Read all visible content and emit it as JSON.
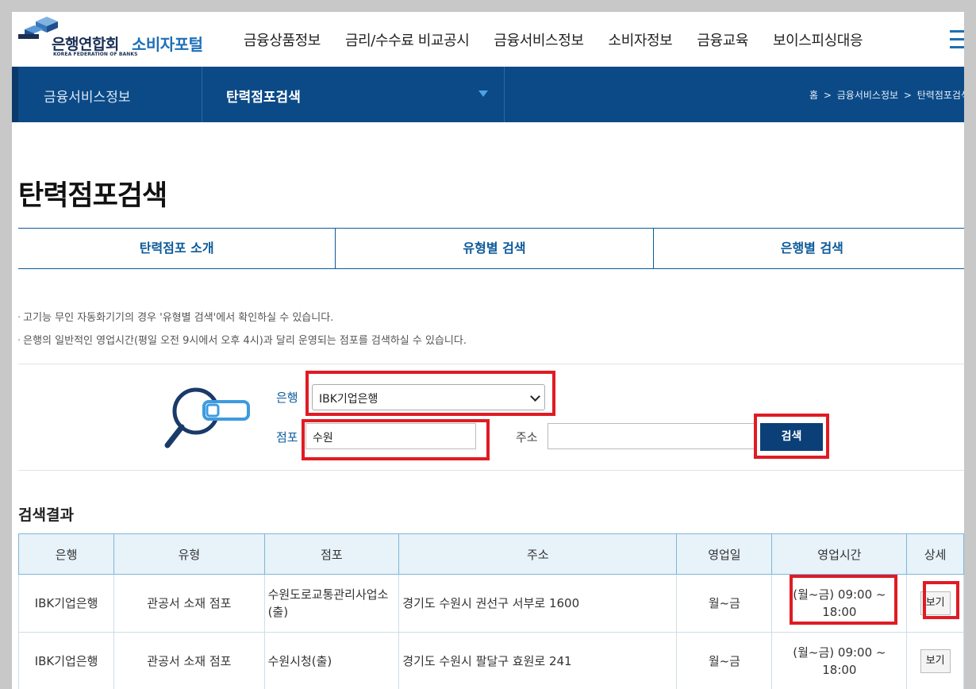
{
  "header": {
    "logo_kr": "은행연합회",
    "logo_en": "KOREA FEDERATION OF BANKS",
    "portal": "소비자포털",
    "gnb": [
      "금융상품정보",
      "금리/수수료 비교공시",
      "금융서비스정보",
      "소비자정보",
      "금융교육",
      "보이스피싱대응"
    ]
  },
  "subnav": {
    "section": "금융서비스정보",
    "current": "탄력점포검색",
    "breadcrumb": [
      "홈",
      ">",
      "금융서비스정보",
      ">",
      "탄력점포검색"
    ]
  },
  "page_title": "탄력점포검색",
  "tabs": [
    "탄력점포 소개",
    "유형별 검색",
    "은행별 검색"
  ],
  "notices": [
    "고기능 무인 자동화기기의 경우 '유형별 검색'에서 확인하실 수 있습니다.",
    "은행의 일반적인 영업시간(평일 오전 9시에서 오후 4시)과 달리 운영되는 점포를 검색하실 수 있습니다."
  ],
  "search": {
    "bank_label": "은행",
    "bank_value": "IBK기업은행",
    "branch_label": "점포",
    "branch_value": "수원",
    "address_label": "주소",
    "address_value": "",
    "button": "검색"
  },
  "results": {
    "title": "검색결과",
    "headers": [
      "은행",
      "유형",
      "점포",
      "주소",
      "영업일",
      "영업시간",
      "상세"
    ],
    "rows": [
      {
        "bank": "IBK기업은행",
        "type": "관공서 소재 점포",
        "branch": "수원도로교통관리사업소(출)",
        "address": "경기도 수원시 권선구 서부로 1600",
        "days": "월~금",
        "hours": "(월~금) 09:00 ~ 18:00",
        "detail": "보기"
      },
      {
        "bank": "IBK기업은행",
        "type": "관공서 소재 점포",
        "branch": "수원시청(출)",
        "address": "경기도 수원시 팔달구 효원로 241",
        "days": "월~금",
        "hours": "(월~금) 09:00 ~ 18:00",
        "detail": "보기"
      }
    ]
  },
  "colors": {
    "primary": "#0b4a87",
    "accent": "#1d6fb7",
    "highlight": "#e01b24"
  }
}
